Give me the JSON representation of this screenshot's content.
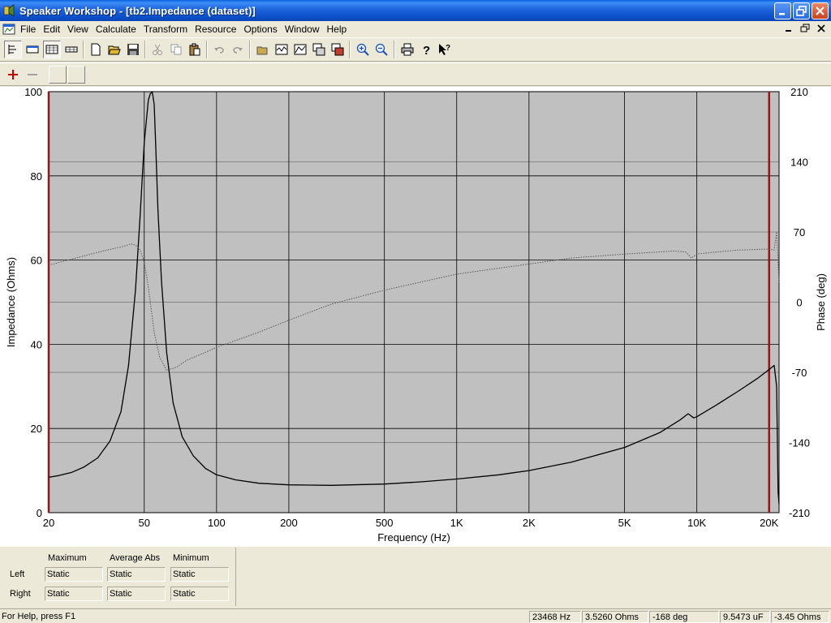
{
  "window": {
    "title": "Speaker Workshop - [tb2.Impedance (dataset)]",
    "title_color": "#0a54d6"
  },
  "menu": [
    "File",
    "Edit",
    "View",
    "Calculate",
    "Transform",
    "Resource",
    "Options",
    "Window",
    "Help"
  ],
  "toolbar": {
    "icons": [
      "tree-view-icon",
      "chart-view-1-icon",
      "chart-view-2-icon",
      "chart-view-3-icon",
      "new-icon",
      "open-icon",
      "save-icon",
      "cut-icon",
      "copy-icon",
      "paste-icon",
      "undo-icon",
      "redo-icon",
      "open-folder-icon",
      "measure-1-icon",
      "measure-2-icon",
      "measure-3-icon",
      "measure-4-icon",
      "zoom-in-icon",
      "zoom-out-icon",
      "print-icon",
      "help-icon",
      "context-help-icon"
    ],
    "marker_icons": [
      "add-marker-icon",
      "remove-marker-icon"
    ]
  },
  "chart_data": {
    "type": "line",
    "xlabel": "Frequency (Hz)",
    "ylabel": "Impedance (Ohms)",
    "y2label": "Phase (deg)",
    "x_scale": "log",
    "xlim": [
      20,
      22000
    ],
    "ylim": [
      0,
      100
    ],
    "y2lim": [
      -210,
      210
    ],
    "x_ticks": [
      {
        "v": 20,
        "label": "20"
      },
      {
        "v": 50,
        "label": "50"
      },
      {
        "v": 100,
        "label": "100"
      },
      {
        "v": 200,
        "label": "200"
      },
      {
        "v": 500,
        "label": "500"
      },
      {
        "v": 1000,
        "label": "1K"
      },
      {
        "v": 2000,
        "label": "2K"
      },
      {
        "v": 5000,
        "label": "5K"
      },
      {
        "v": 10000,
        "label": "10K"
      },
      {
        "v": 20000,
        "label": "20K"
      }
    ],
    "y_ticks": [
      0,
      20,
      40,
      60,
      80,
      100
    ],
    "y2_ticks": [
      -210,
      -140,
      -70,
      0,
      70,
      140,
      210
    ],
    "plot_bg": "#c0c0c0",
    "grid": true,
    "markers": [
      {
        "x": 20,
        "color": "#8b1a1a"
      },
      {
        "x": 20000,
        "color": "#8b1a1a"
      }
    ],
    "series": [
      {
        "axis": "left",
        "color": "#000000",
        "style": "solid",
        "x": [
          20,
          22,
          25,
          28,
          32,
          36,
          40,
          43,
          46,
          48,
          50,
          52,
          53,
          54,
          55,
          56,
          57,
          59,
          62,
          66,
          72,
          80,
          90,
          100,
          120,
          150,
          200,
          300,
          500,
          700,
          1000,
          1500,
          2000,
          3000,
          5000,
          7000,
          8500,
          9200,
          9700,
          10000,
          12000,
          15000,
          18000,
          20000,
          21000,
          21500,
          21800,
          22000
        ],
        "y": [
          8.4,
          8.8,
          9.6,
          10.8,
          13,
          17,
          24,
          35,
          53,
          70,
          88,
          98,
          99.5,
          100,
          97,
          85,
          72,
          55,
          38,
          26,
          18,
          13.5,
          10.5,
          9,
          7.8,
          7,
          6.6,
          6.5,
          6.8,
          7.3,
          8,
          9,
          10,
          12,
          15.5,
          19,
          22,
          23.5,
          22.5,
          22.8,
          25.5,
          29,
          32,
          34,
          35,
          30,
          5,
          2
        ]
      },
      {
        "axis": "right",
        "color": "#5a5a5a",
        "style": "dotted",
        "x": [
          20,
          25,
          30,
          35,
          40,
          44,
          46,
          48,
          50,
          52,
          55,
          58,
          62,
          68,
          75,
          90,
          100,
          150,
          200,
          300,
          500,
          1000,
          2000,
          3000,
          5000,
          8000,
          9000,
          9500,
          10000,
          12000,
          15000,
          20000,
          21000,
          21500,
          22000
        ],
        "y": [
          37,
          43,
          48,
          52,
          55,
          58,
          57,
          52,
          40,
          15,
          -30,
          -55,
          -68,
          -65,
          -58,
          -50,
          -45,
          -30,
          -18,
          -2,
          12,
          28,
          38,
          44,
          48,
          51,
          50,
          44,
          48,
          50,
          52,
          53,
          52,
          70,
          20
        ]
      }
    ]
  },
  "stats": {
    "headers": [
      "Maximum",
      "Average Abs",
      "Minimum"
    ],
    "rows": [
      {
        "label": "Left",
        "values": [
          "Static",
          "Static",
          "Static"
        ]
      },
      {
        "label": "Right",
        "values": [
          "Static",
          "Static",
          "Static"
        ]
      }
    ]
  },
  "statusbar": {
    "help": "For Help, press F1",
    "freq": "23468 Hz",
    "impedance": "3.5260 Ohms",
    "phase": "-168 deg",
    "capacitance": "9.5473 uF",
    "reactance": "-3.45 Ohms"
  }
}
